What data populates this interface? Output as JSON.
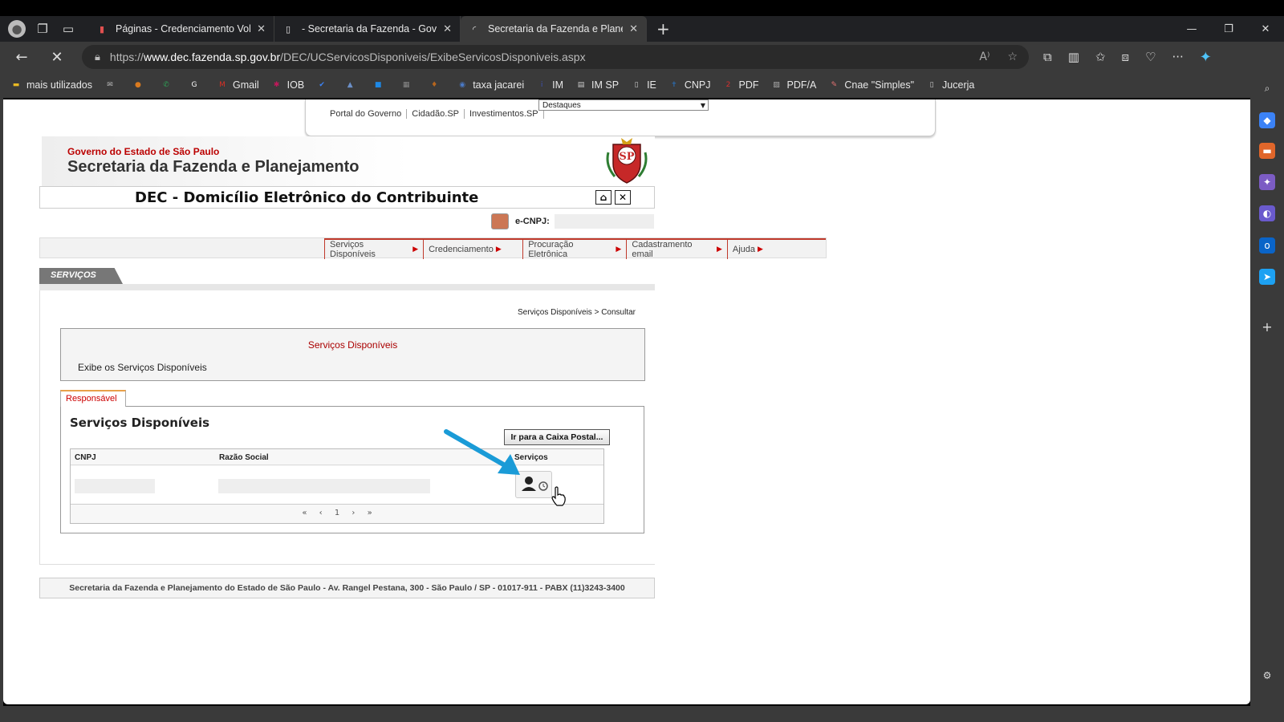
{
  "browser": {
    "tabs": [
      {
        "title": "Páginas - Credenciamento Volun",
        "active": false
      },
      {
        "title": "- Secretaria da Fazenda - Govern",
        "active": false
      },
      {
        "title": "Secretaria da Fazenda e Planejam",
        "active": true
      }
    ],
    "url": {
      "scheme": "https://",
      "host": "www.dec.fazenda.sp.gov.br",
      "path": "/DEC/UCServicosDisponiveis/ExibeServicosDisponiveis.aspx"
    },
    "bookmarks": [
      {
        "label": "mais utilizados",
        "icon": "folder-icon",
        "color": "#e8b923"
      },
      {
        "label": "",
        "icon": "mail-icon",
        "color": "#bbbbbb"
      },
      {
        "label": "",
        "icon": "orange-circle-icon",
        "color": "#d97a1f"
      },
      {
        "label": "",
        "icon": "whatsapp-icon",
        "color": "#2e9e55"
      },
      {
        "label": "",
        "icon": "google-icon",
        "color": "#ffffff"
      },
      {
        "label": "Gmail",
        "icon": "gmail-icon",
        "color": "#d93025"
      },
      {
        "label": "IOB",
        "icon": "iob-icon",
        "color": "#c2185b"
      },
      {
        "label": "",
        "icon": "check-icon",
        "color": "#3b82f6"
      },
      {
        "label": "",
        "icon": "building-icon",
        "color": "#6b8fc7"
      },
      {
        "label": "",
        "icon": "blue-square-icon",
        "color": "#1e88e5"
      },
      {
        "label": "",
        "icon": "qr-icon",
        "color": "#888888"
      },
      {
        "label": "",
        "icon": "crest-icon",
        "color": "#b5651d"
      },
      {
        "label": "taxa jacarei",
        "icon": "globe-icon",
        "color": "#4a7ac7"
      },
      {
        "label": "IM",
        "icon": "iss-icon",
        "color": "#3f51b5"
      },
      {
        "label": "IM SP",
        "icon": "doc-icon",
        "color": "#cccccc"
      },
      {
        "label": "IE",
        "icon": "page-icon",
        "color": "#cccccc"
      },
      {
        "label": "CNPJ",
        "icon": "cross-icon",
        "color": "#2b6cb0"
      },
      {
        "label": "PDF",
        "icon": "pdf-icon",
        "color": "#d32f2f"
      },
      {
        "label": "PDF/A",
        "icon": "image-icon",
        "color": "#aaaaaa"
      },
      {
        "label": "Cnae \"Simples\"",
        "icon": "pencil-icon",
        "color": "#e57373"
      },
      {
        "label": "Jucerja",
        "icon": "page-icon",
        "color": "#cccccc"
      }
    ]
  },
  "gov_bar": {
    "links": [
      "Portal do Governo",
      "Cidadão.SP",
      "Investimentos.SP"
    ],
    "select_value": "Destaques"
  },
  "header": {
    "gov": "Governo do Estado de São Paulo",
    "secretaria": "Secretaria da Fazenda e Planejamento",
    "crest_text": "SP"
  },
  "dec": {
    "title": "DEC - Domicílio Eletrônico do Contribuinte",
    "home_glyph": "⌂",
    "close_glyph": "✕",
    "ecnpj_label": "e-CNPJ:"
  },
  "menu": [
    "Serviços Disponíveis",
    "Credenciamento",
    "Procuração Eletrônica",
    "Cadastramento email",
    "Ajuda"
  ],
  "section_tab": "SERVIÇOS",
  "breadcrumb": "Serviços Disponíveis > Consultar",
  "info": {
    "heading": "Serviços Disponíveis",
    "description": "Exibe os Serviços Disponíveis"
  },
  "panel": {
    "tab_label": "Responsável",
    "title": "Serviços Disponíveis",
    "caixa_button": "Ir para a Caixa Postal...",
    "columns": [
      "CNPJ",
      "Razão Social",
      "Serviços"
    ],
    "pager": [
      "«",
      "‹",
      "1",
      "›",
      "»"
    ]
  },
  "footer": "Secretaria da Fazenda e Planejamento do Estado de São Paulo - Av. Rangel Pestana, 300 - São Paulo / SP - 01017-911 - PABX (11)3243-3400",
  "colors": {
    "accent_red": "#c0392b",
    "arrow": "#1a9bd7"
  }
}
